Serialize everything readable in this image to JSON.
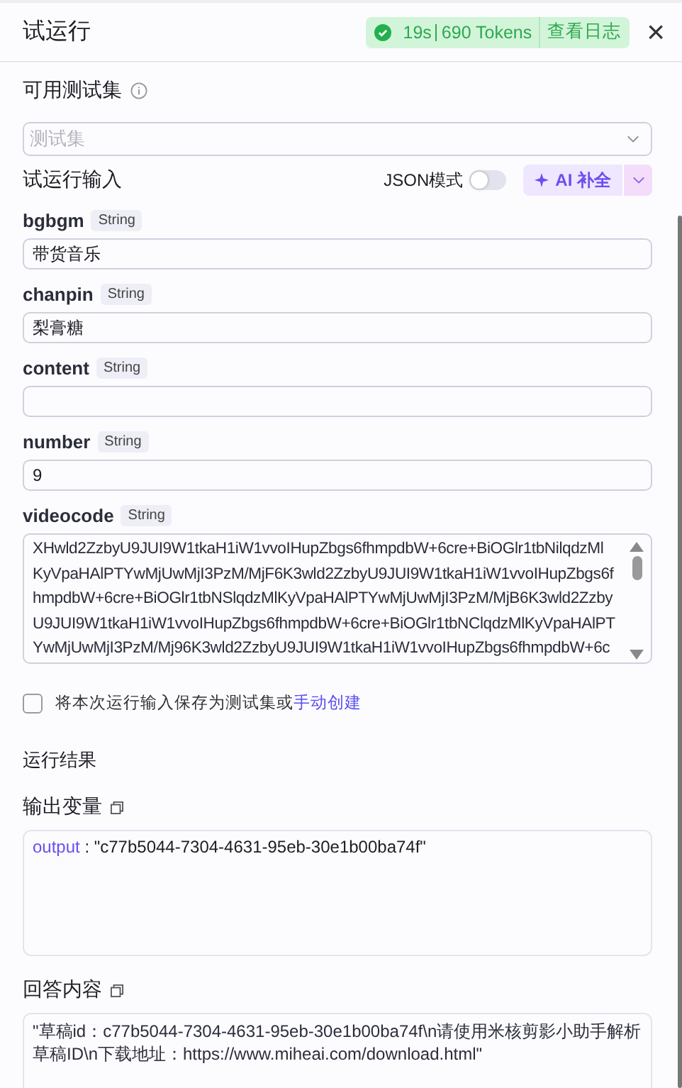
{
  "header": {
    "title": "试运行",
    "status": {
      "ok": true,
      "time": "19s",
      "tokens": "690 Tokens",
      "log_link": "查看日志"
    },
    "close": "×"
  },
  "test_set": {
    "label": "可用测试集",
    "placeholder": "测试集"
  },
  "input_section": {
    "title": "试运行输入",
    "json_mode": {
      "label": "JSON模式",
      "on": false
    },
    "ai_button": "AI 补全"
  },
  "fields": [
    {
      "name": "bgbgm",
      "type": "String",
      "value": "带货音乐",
      "kind": "input"
    },
    {
      "name": "chanpin",
      "type": "String",
      "value": "梨膏糖",
      "kind": "input"
    },
    {
      "name": "content",
      "type": "String",
      "kind": "input"
    },
    {
      "name": "number",
      "type": "String",
      "value": "9",
      "kind": "input"
    },
    {
      "name": "videocode",
      "type": "String",
      "kind": "textarea",
      "lines": [
        "XHwld2ZzbyU9JUI9W1tkaH1iW1vvoIHupZbgs6fhmpdbW+6cre+BiOGlr1tbNilqdzMl",
        "KyVpaHAlPTYwMjUwMjI3PzM/MjF6K3wld2ZzbyU9JUI9W1tkaH1iW1vvoIHupZbgs6f",
        "hmpdbW+6cre+BiOGlr1tbNSlqdzMlKyVpaHAlPTYwMjUwMjI3PzM/MjB6K3wld2Zzby",
        "U9JUI9W1tkaH1iW1vvoIHupZbgs6fhmpdbW+6cre+BiOGlr1tbNClqdzMlKyVpaHAlPT",
        "YwMjUwMjI3PzM/Mj96K3wld2ZzbyU9JUI9W1tkaH1iW1vvoIHupZbgs6fhmpdbW+6c"
      ]
    }
  ],
  "save": {
    "checked": false,
    "text": "将本次运行输入保存为测试集或",
    "link": "手动创建"
  },
  "result": {
    "title": "运行结果",
    "output_label": "输出变量",
    "output_key": "output",
    "output_separator": ":",
    "output_value": "\"c77b5044-7304-4631-95eb-30e1b00ba74f\"",
    "answer_label": "回答内容",
    "answer": "\"草稿id：c77b5044-7304-4631-95eb-30e1b00ba74f\\n请使用米核剪影小助手解析草稿ID\\n下载地址：https://www.miheai.com/download.html\""
  }
}
